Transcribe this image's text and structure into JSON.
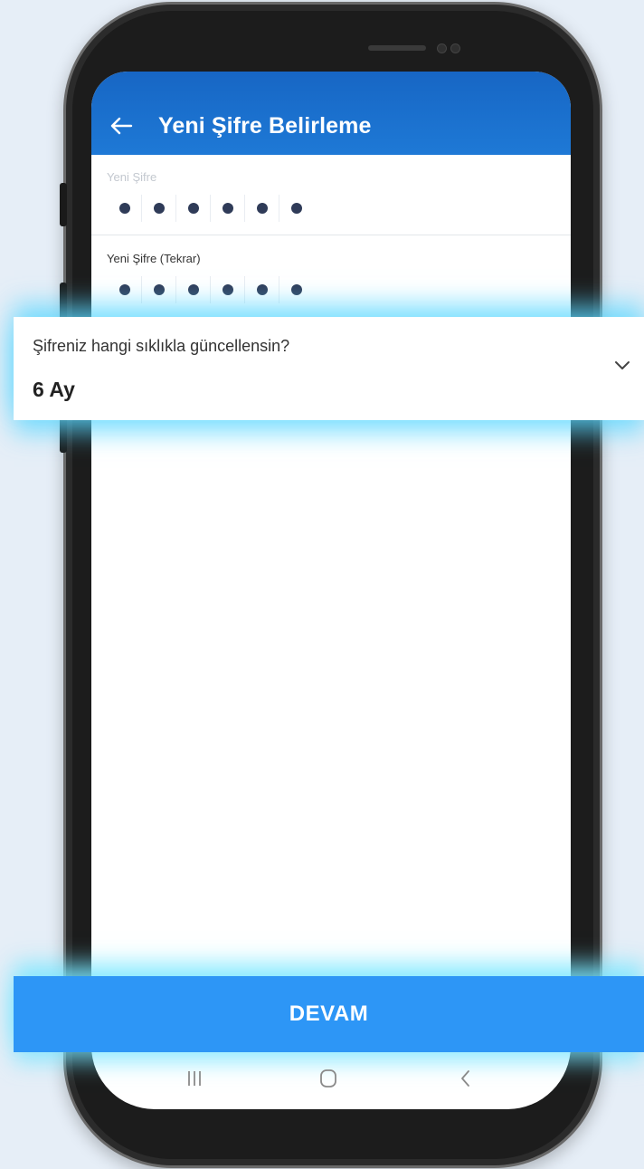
{
  "appbar": {
    "title": "Yeni Şifre Belirleme",
    "back_icon": "arrow-left-icon"
  },
  "fields": [
    {
      "label": "Yeni Şifre",
      "dots": 6
    },
    {
      "label": "Yeni Şifre (Tekrar)",
      "dots": 6
    }
  ],
  "update_frequency": {
    "question": "Şifreniz hangi sıklıkla güncellensin?",
    "selected": "6 Ay",
    "icon": "chevron-down-icon"
  },
  "continue_button": {
    "label": "DEVAM"
  },
  "android_nav": {
    "icons": [
      "recents-icon",
      "home-icon",
      "back-icon"
    ]
  },
  "colors": {
    "appbar": "#1766c4",
    "button": "#2d96f6",
    "glow": "#5ad7ff",
    "dot": "#2f3b58"
  }
}
